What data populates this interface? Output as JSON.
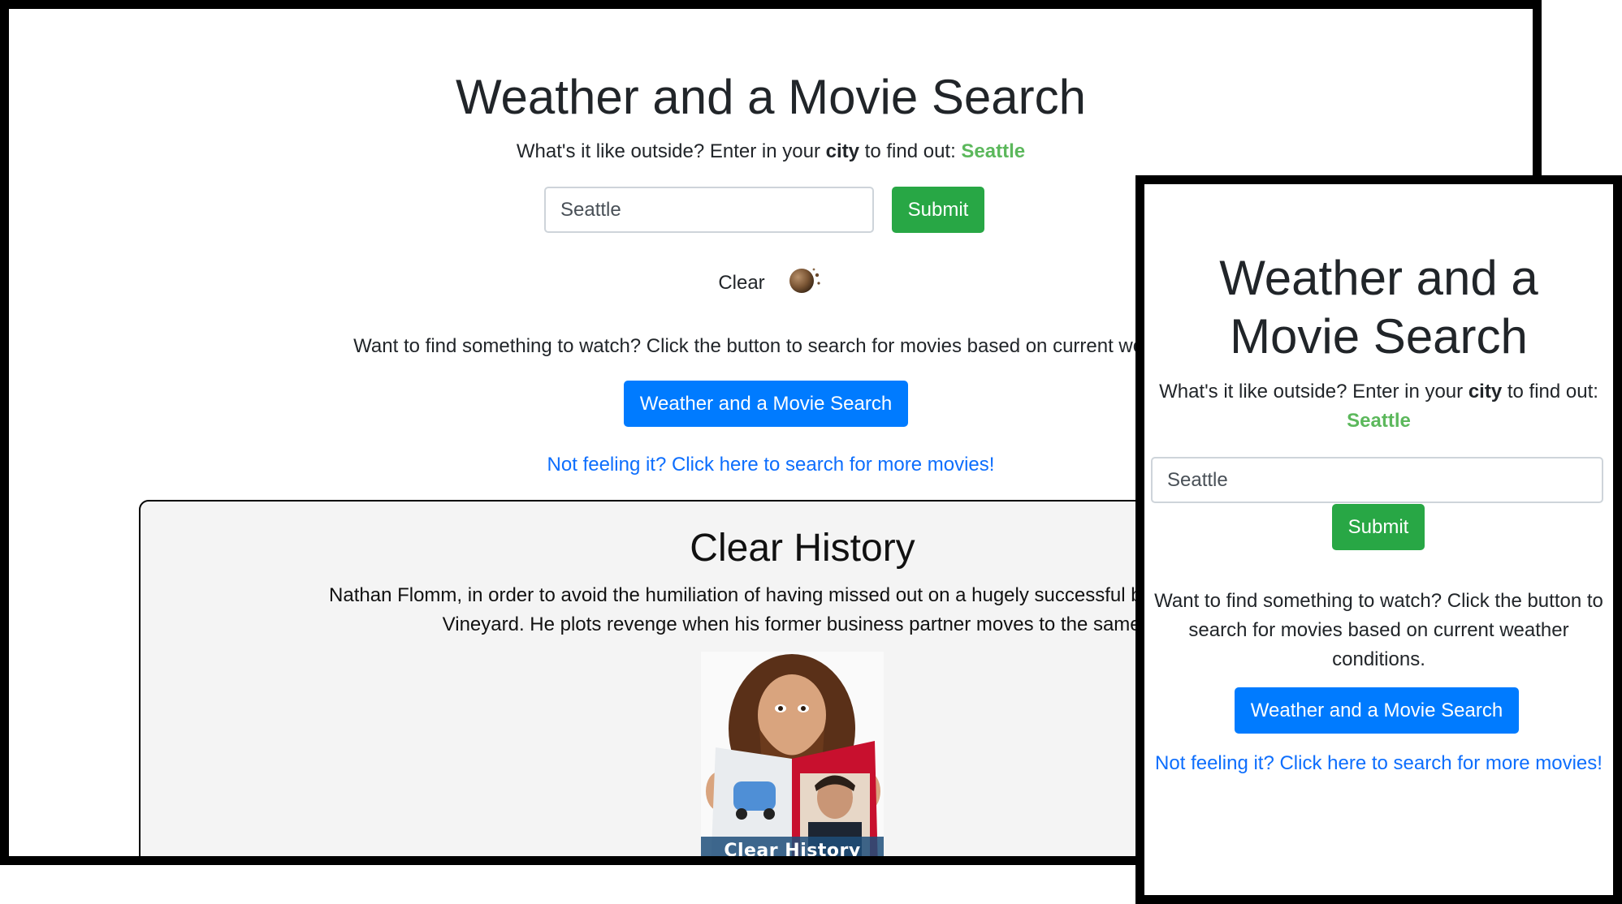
{
  "desktop": {
    "title": "Weather and a Movie Search",
    "intro_prefix": "What's it like outside? Enter in your",
    "intro_bold": "city",
    "intro_suffix": "to find out:",
    "city_name": "Seattle",
    "city_input_value": "Seattle",
    "submit_label": "Submit",
    "weather_condition": "Clear",
    "weather_icon": "moon-icon",
    "watch_prompt": "Want to find something to watch? Click the button to search for movies based on current weather",
    "search_button_label": "Weather and a Movie Search",
    "more_movies_link": "Not feeling it? Click here to search for more movies!",
    "movie": {
      "title": "Clear History",
      "plot_line1": "Nathan Flomm, in order to avoid the humiliation of having missed out on a hugely successful business, assum",
      "plot_line2": "Vineyard. He plots revenge when his former business partner moves to the same to",
      "poster_caption": "Clear History"
    }
  },
  "mobile": {
    "title_line1": "Weather and a",
    "title_line2": "Movie Search",
    "intro_prefix": "What's it like outside? Enter in your",
    "intro_bold": "city",
    "intro_suffix": "to find out:",
    "city_name": "Seattle",
    "city_input_value": "Seattle",
    "submit_label": "Submit",
    "watch_prompt": "Want to find something to watch? Click the button to search for movies based on current weather conditions.",
    "search_button_label": "Weather and a Movie Search",
    "more_movies_link": "Not feeling it? Click here to search for more movies!"
  },
  "colors": {
    "city_green": "#5cb85c",
    "submit_green": "#28a745",
    "primary_blue": "#007bff",
    "link_blue": "#0d6efd",
    "card_background": "#f4f4f4"
  }
}
